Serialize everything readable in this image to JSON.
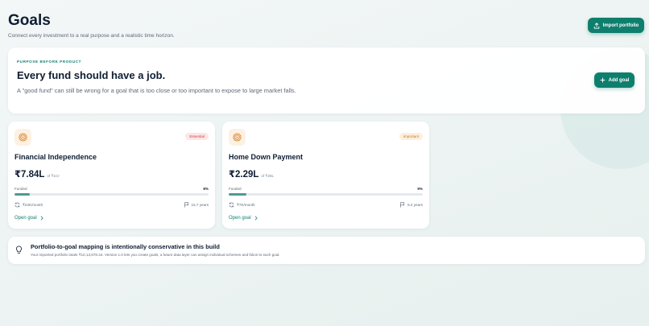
{
  "header": {
    "title": "Goals",
    "subtitle": "Connect every investment to a real purpose and a realistic time horizon.",
    "import_label": "Import portfolio"
  },
  "hero": {
    "eyebrow": "PURPOSE BEFORE PRODUCT",
    "title": "Every fund should have a job.",
    "text": "A \"good fund\" can still be wrong for a goal that is too close or too important to expose to large market falls.",
    "add_goal_label": "Add goal"
  },
  "goals": [
    {
      "name": "Financial Independence",
      "badge": "Essential",
      "amount": "₹7.84L",
      "target": "of ₹1Cr",
      "funded_label": "Funded",
      "funded_pct": "8%",
      "funded_fraction": 0.08,
      "monthly": "₹22K/month",
      "horizon": "15.7 years",
      "open_label": "Open goal",
      "icon": "target-icon"
    },
    {
      "name": "Home Down Payment",
      "badge": "Important",
      "amount": "₹2.29L",
      "target": "of ₹25L",
      "funded_label": "Funded",
      "funded_pct": "9%",
      "funded_fraction": 0.09,
      "monthly": "₹7K/month",
      "horizon": "5.4 years",
      "open_label": "Open goal",
      "icon": "target-icon"
    }
  ],
  "note": {
    "title": "Portfolio-to-goal mapping is intentionally conservative in this build",
    "text": "Your imported portfolio totals ₹10,13,878.44. Version 1.0 lets you create goals; a future data layer can assign individual schemes and folios to each goal."
  },
  "colors": {
    "accent": "#0f7f6d",
    "progress": "#4e9a93",
    "essential_bg": "#fde6e6",
    "essential_text": "#c94646",
    "important_bg": "#fdefdc",
    "important_text": "#c97a2a"
  }
}
